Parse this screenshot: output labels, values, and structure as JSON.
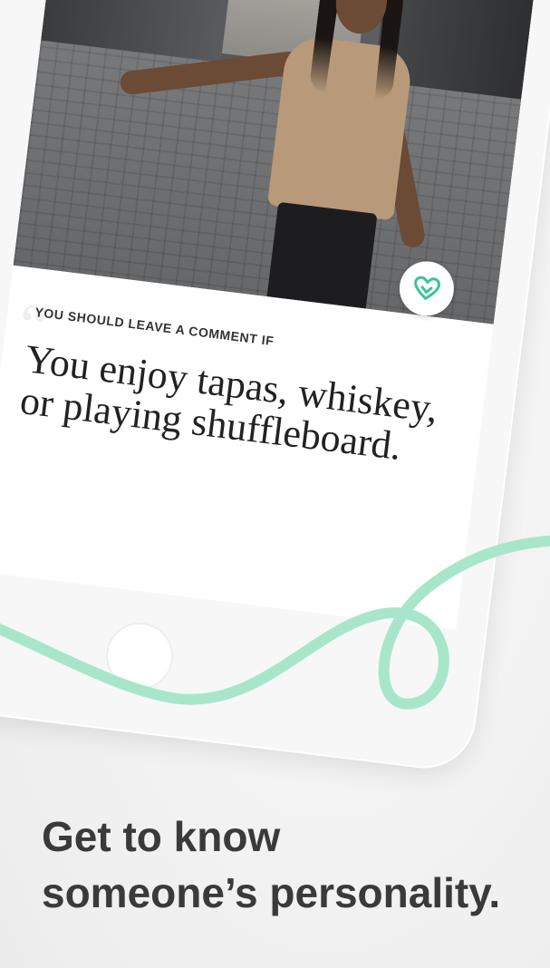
{
  "card": {
    "prompt_heading": "YOU SHOULD LEAVE A COMMENT IF",
    "prompt_answer": "You enjoy tapas, whiskey, or playing shuffleboard.",
    "like_icon": "heart-outline-icon",
    "quote_icon": "quote-icon"
  },
  "tagline": {
    "line1": "Get to know",
    "line2": "someone’s personality."
  },
  "colors": {
    "accent": "#9fe2c4",
    "heart": "#3cc29a",
    "tagline": "#3a3a3a"
  }
}
